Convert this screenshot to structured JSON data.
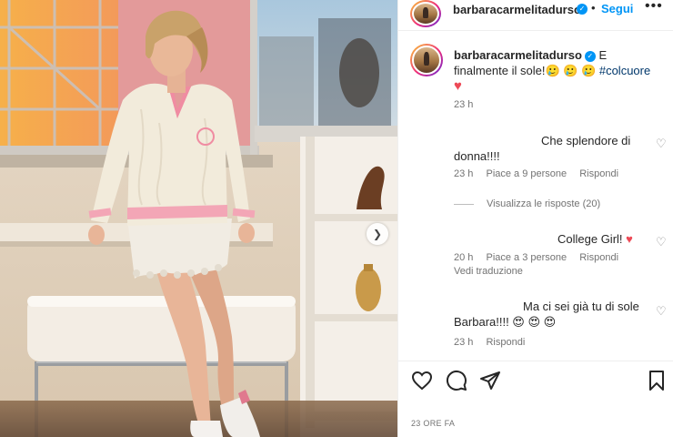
{
  "post": {
    "username": "barbaracarmelitadurso",
    "follow_label": "Segui",
    "caption_text": "E finalmente il sole!🥲 🥲 🥲 ",
    "caption_hashtag": "#colcuore",
    "caption_emoji": "♥",
    "caption_time": "23 h",
    "footer_time": "23 ORE FA"
  },
  "comments": [
    {
      "text_line1": "Che splendore di",
      "text_line2": "donna!!!!",
      "time": "23 h",
      "likes": "Piace a 9 persone",
      "reply": "Rispondi",
      "view_replies": "Visualizza le risposte (20)"
    },
    {
      "text": "College Girl! ",
      "emoji": "♥",
      "time": "20 h",
      "likes": "Piace a 3 persone",
      "reply": "Rispondi",
      "translate": "Vedi traduzione"
    },
    {
      "text_line1": "Ma ci sei già tu di sole",
      "text_line2": "Barbara!!!! 😍 😍 😍",
      "time": "23 h",
      "reply": "Rispondi"
    }
  ],
  "icons": {
    "verified": "verified-badge-icon",
    "more": "more-options-icon",
    "next": "chevron-right-icon",
    "like": "heart-icon",
    "comment": "comment-icon",
    "share": "paper-plane-icon",
    "save": "bookmark-icon"
  },
  "colors": {
    "link_blue": "#0095f6",
    "heart_red": "#ed4956",
    "muted": "#737373"
  }
}
